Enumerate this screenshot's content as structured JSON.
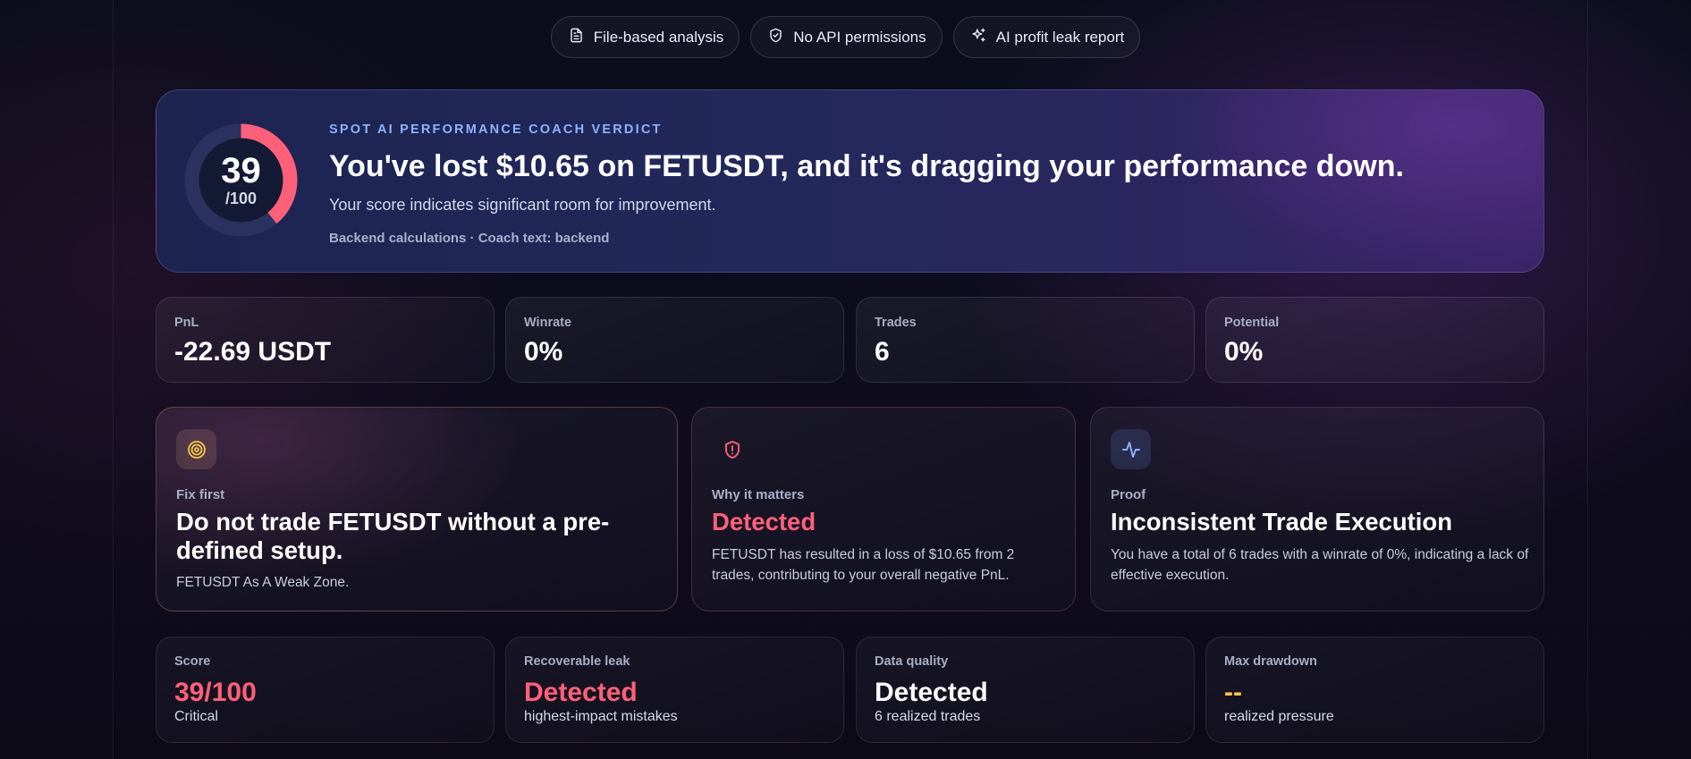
{
  "pills": [
    {
      "icon": "document-icon",
      "label": "File-based analysis"
    },
    {
      "icon": "shield-check-icon",
      "label": "No API permissions"
    },
    {
      "icon": "sparkles-icon",
      "label": "AI profit leak report"
    }
  ],
  "hero": {
    "score": "39",
    "score_max": "/100",
    "score_fraction": 0.39,
    "eyebrow": "SPOT AI PERFORMANCE COACH VERDICT",
    "title": "You've lost $10.65 on FETUSDT, and it's dragging your performance down.",
    "subtitle": "Your score indicates significant room for improvement.",
    "meta": "Backend calculations · Coach text: backend"
  },
  "stats": [
    {
      "label": "PnL",
      "value": "-22.69 USDT"
    },
    {
      "label": "Winrate",
      "value": "0%"
    },
    {
      "label": "Trades",
      "value": "6"
    },
    {
      "label": "Potential",
      "value": "0%"
    }
  ],
  "insights": {
    "fix_first": {
      "icon": "target-icon",
      "label": "Fix first",
      "title": "Do not trade FETUSDT without a pre-defined setup.",
      "body": "FETUSDT As A Weak Zone."
    },
    "why_it_matters": {
      "icon": "shield-alert-icon",
      "label": "Why it matters",
      "title": "Detected",
      "body": "FETUSDT has resulted in a loss of $10.65 from 2 trades, contributing to your overall negative PnL."
    },
    "proof": {
      "icon": "activity-icon",
      "label": "Proof",
      "title": "Inconsistent Trade Execution",
      "body": "You have a total of 6 trades with a winrate of 0%, indicating a lack of effective execution."
    }
  },
  "summary": [
    {
      "label": "Score",
      "value": "39/100",
      "sub": "Critical"
    },
    {
      "label": "Recoverable leak",
      "value": "Detected",
      "sub": "highest-impact mistakes"
    },
    {
      "label": "Data quality",
      "value": "Detected",
      "sub": "6 realized trades"
    },
    {
      "label": "Max drawdown",
      "value": "--",
      "sub": "realized pressure"
    }
  ],
  "colors": {
    "accent_red": "#ff6079",
    "accent_blue": "#8fb2ff",
    "accent_amber": "#f7c948"
  }
}
